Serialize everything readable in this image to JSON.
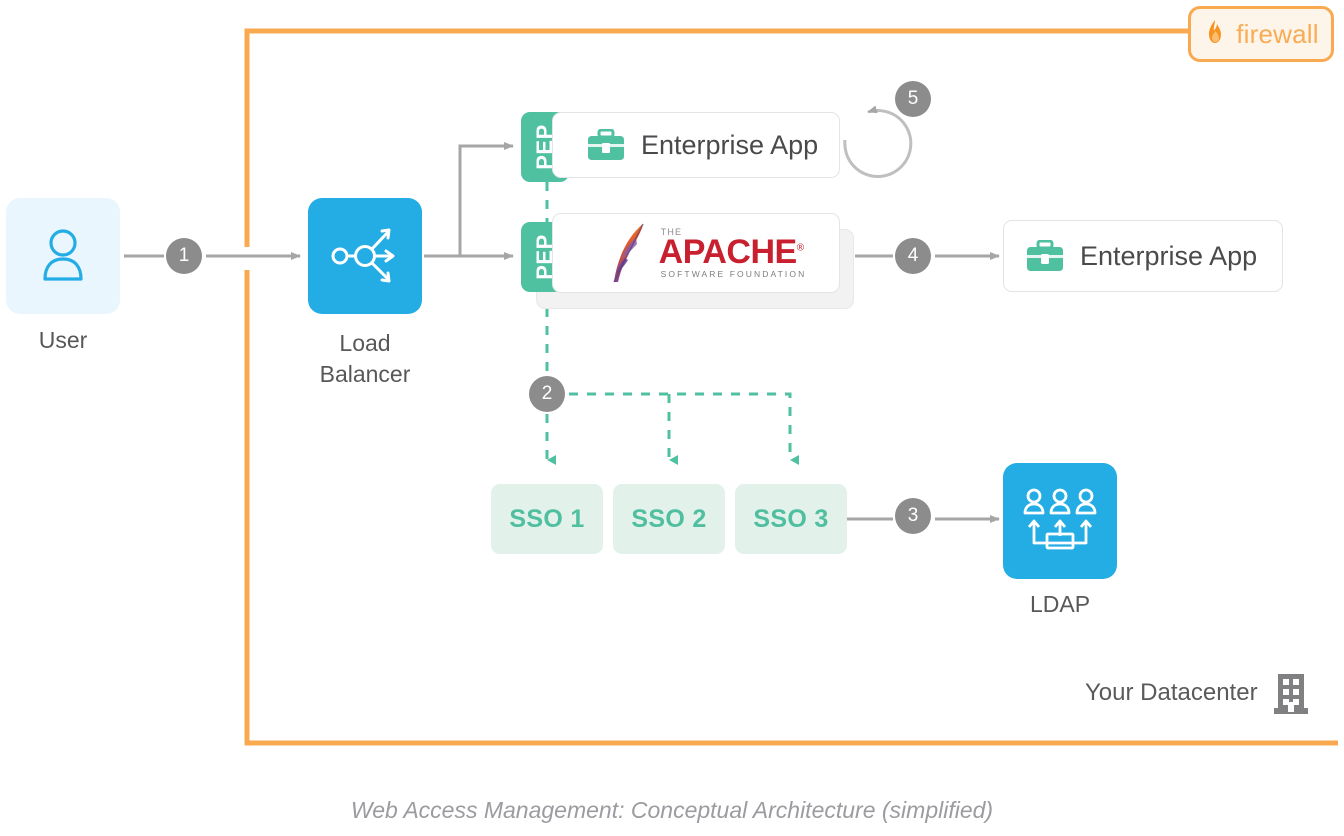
{
  "diagram": {
    "caption": "Web Access Management: Conceptual Architecture (simplified)",
    "boundary": {
      "name": "firewall",
      "badge_label": "firewall",
      "badge_icon": "flame-icon",
      "color": "#f9a94f"
    },
    "colors": {
      "blue": "#24ace4",
      "blue_light": "#e9f6fd",
      "green": "#4fc0a0",
      "green_light": "#e2f1ea",
      "orange": "#f9a94f",
      "gray_badge": "#8c8c8c",
      "text_dark": "#4a4a4c",
      "caption": "#9b9ba0",
      "apache_red": "#c8202f"
    },
    "nodes": {
      "user": {
        "label": "User",
        "icon": "user-icon"
      },
      "load_balancer": {
        "label": "Load\nBalancer",
        "label_line1": "Load",
        "label_line2": "Balancer",
        "icon": "load-balancer-icon"
      },
      "enterprise_app_top": {
        "label": "Enterprise App",
        "icon": "briefcase-icon",
        "pep_label": "PEP"
      },
      "apache": {
        "pep_label": "PEP",
        "logo_the": "THE",
        "logo_main": "APACHE",
        "logo_tm": "®",
        "logo_sub": "SOFTWARE FOUNDATION",
        "icon": "apache-feather-icon"
      },
      "enterprise_app_right": {
        "label": "Enterprise App",
        "icon": "briefcase-icon"
      },
      "sso": [
        {
          "label": "SSO 1"
        },
        {
          "label": "SSO 2"
        },
        {
          "label": "SSO 3"
        }
      ],
      "ldap": {
        "label": "LDAP",
        "icon": "ldap-directory-icon"
      },
      "datacenter": {
        "label": "Your Datacenter",
        "icon": "building-icon"
      }
    },
    "steps": [
      {
        "number": "1",
        "description": "User to Load Balancer"
      },
      {
        "number": "2",
        "description": "PEP to SSO services"
      },
      {
        "number": "3",
        "description": "SSO 3 to LDAP"
      },
      {
        "number": "4",
        "description": "Apache to Enterprise App"
      },
      {
        "number": "5",
        "description": "Enterprise App self loop"
      }
    ]
  }
}
